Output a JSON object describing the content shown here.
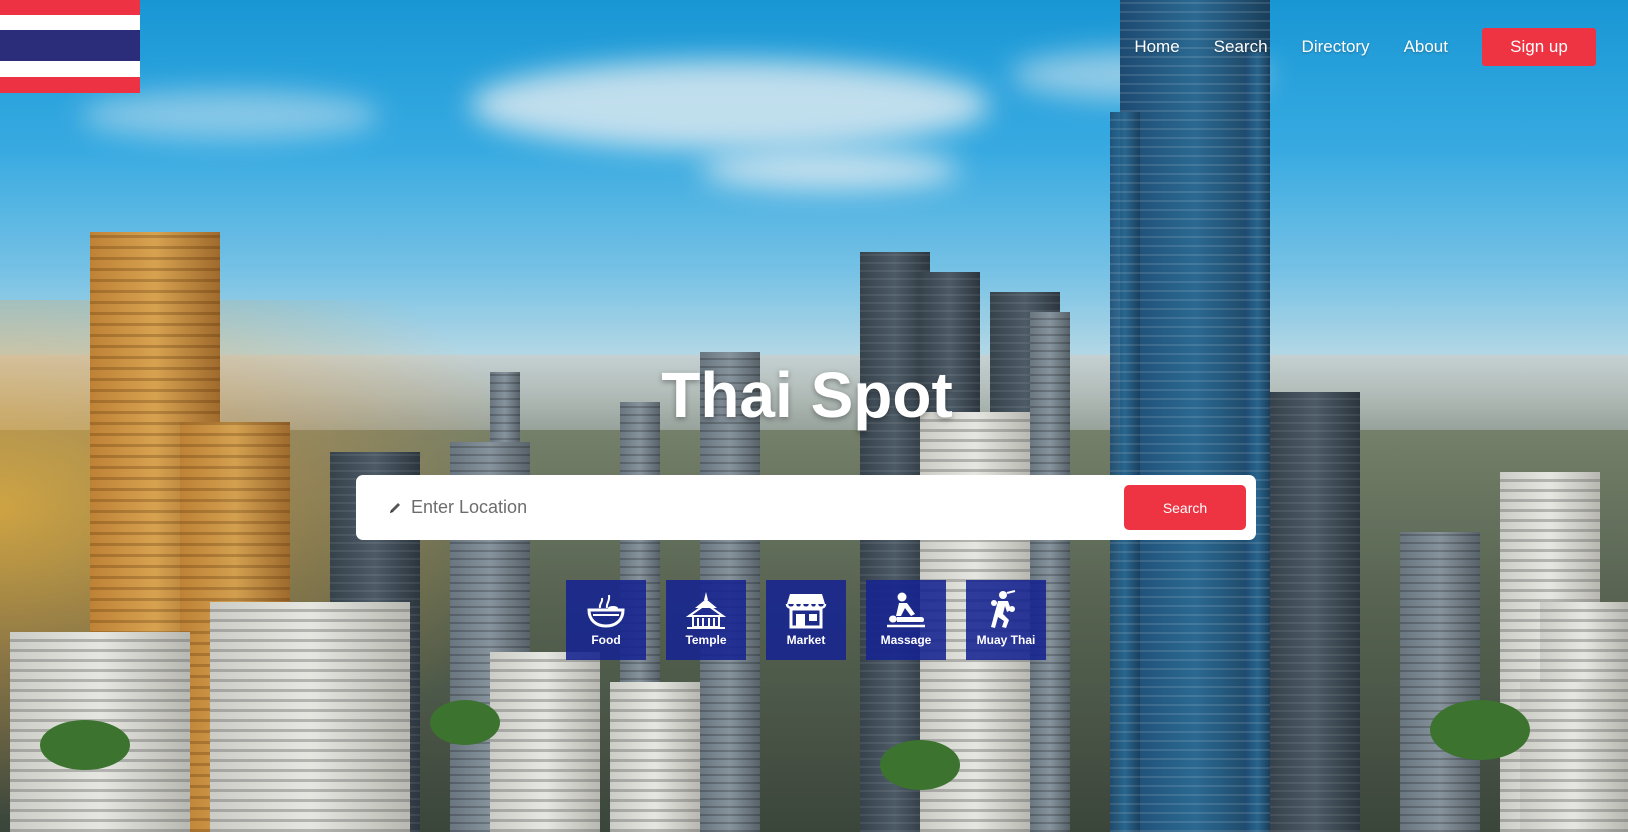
{
  "brand": {
    "flag_stripes": [
      "#ED3343",
      "#FFFFFF",
      "#2B2D7A",
      "#FFFFFF",
      "#ED3343"
    ],
    "accent_color": "#EE3343",
    "category_tile_color": "#162391"
  },
  "nav": {
    "links": [
      {
        "label": "Home"
      },
      {
        "label": "Search"
      },
      {
        "label": "Directory"
      },
      {
        "label": "About"
      }
    ],
    "signup_label": "Sign up"
  },
  "hero": {
    "title": "Thai Spot"
  },
  "search": {
    "icon": "pencil-icon",
    "placeholder": "Enter Location",
    "value": "",
    "button_label": "Search"
  },
  "categories": [
    {
      "label": "Food",
      "icon": "food-bowl-icon"
    },
    {
      "label": "Temple",
      "icon": "temple-icon"
    },
    {
      "label": "Market",
      "icon": "market-icon"
    },
    {
      "label": "Massage",
      "icon": "massage-icon"
    },
    {
      "label": "Muay Thai",
      "icon": "muay-thai-icon"
    }
  ]
}
